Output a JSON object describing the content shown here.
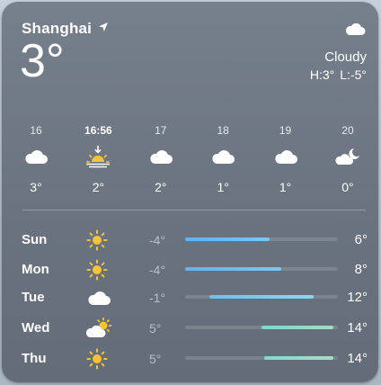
{
  "location": {
    "city": "Shanghai",
    "icon": "location-arrow-icon"
  },
  "current": {
    "temp": "3°",
    "condition": "Cloudy",
    "condition_icon": "cloud-icon",
    "high": "H:3°",
    "low": "L:-5°"
  },
  "hourly": [
    {
      "time": "16",
      "icon": "cloud-icon",
      "temp": "3°"
    },
    {
      "time": "16:56",
      "icon": "sunset-icon",
      "temp": "2°"
    },
    {
      "time": "17",
      "icon": "cloud-icon",
      "temp": "2°"
    },
    {
      "time": "18",
      "icon": "cloud-icon",
      "temp": "1°"
    },
    {
      "time": "19",
      "icon": "cloud-icon",
      "temp": "1°"
    },
    {
      "time": "20",
      "icon": "cloud-moon-icon",
      "temp": "0°"
    }
  ],
  "daily": [
    {
      "day": "Sun",
      "icon": "sun-icon",
      "low": "-4°",
      "high": "6°",
      "range_start": 0.0,
      "range_end": 0.55,
      "colors": [
        "#5fb3f0",
        "#7ac6f5"
      ]
    },
    {
      "day": "Mon",
      "icon": "sun-icon",
      "low": "-4°",
      "high": "8°",
      "range_start": 0.0,
      "range_end": 0.63,
      "colors": [
        "#5fb3f0",
        "#7ac6f5"
      ]
    },
    {
      "day": "Tue",
      "icon": "cloud-icon",
      "low": "-1°",
      "high": "12°",
      "range_start": 0.16,
      "range_end": 0.84,
      "colors": [
        "#6cc0f3",
        "#8fd4ee"
      ]
    },
    {
      "day": "Wed",
      "icon": "sun-behind-cloud-icon",
      "low": "5°",
      "high": "14°",
      "range_start": 0.5,
      "range_end": 0.97,
      "colors": [
        "#7fd6cf",
        "#a5dcc0"
      ]
    },
    {
      "day": "Thu",
      "icon": "sun-icon",
      "low": "5°",
      "high": "14°",
      "range_start": 0.52,
      "range_end": 0.97,
      "colors": [
        "#86d7d4",
        "#a9dcc4"
      ]
    }
  ]
}
